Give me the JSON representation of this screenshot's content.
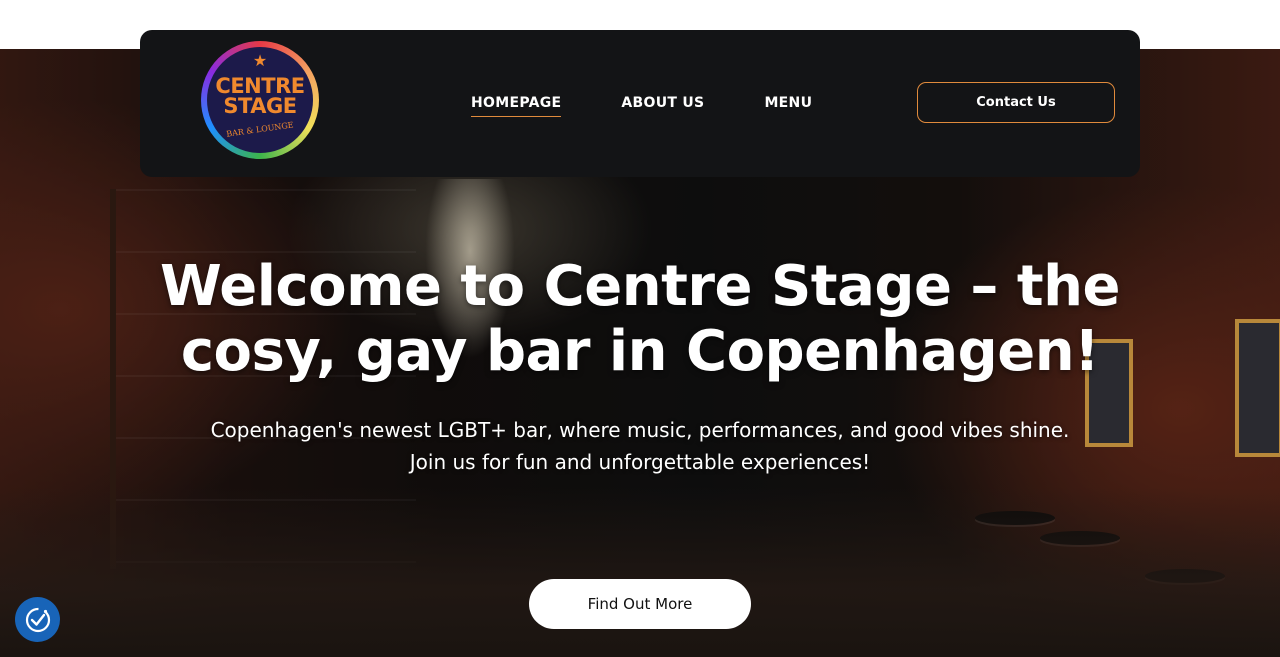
{
  "brand": {
    "logo_line1": "CENTRE",
    "logo_line2": "STAGE",
    "logo_sub": "BAR & LOUNGE",
    "ring_colors": [
      "#e63946",
      "#f4a261",
      "#f1e05a",
      "#3cb44b",
      "#1e90ff",
      "#8a2be2"
    ],
    "accent": "#f0892e"
  },
  "nav": {
    "items": [
      {
        "label": "HOMEPAGE",
        "active": true
      },
      {
        "label": "ABOUT US",
        "active": false
      },
      {
        "label": "MENU",
        "active": false
      }
    ],
    "contact_label": "Contact Us"
  },
  "hero": {
    "title": "Welcome to Centre Stage – the cosy, gay bar in Copenhagen!",
    "subtitle": "Copenhagen's newest LGBT+ bar, where music, performances, and good vibes shine. Join us for fun and unforgettable experiences!",
    "cta_label": "Find Out More"
  },
  "widgets": {
    "consent_icon": "cookie-consent-icon",
    "consent_color": "#1864b8"
  },
  "colors": {
    "navbar_bg": "#131416",
    "nav_accent": "#e08a3c"
  }
}
